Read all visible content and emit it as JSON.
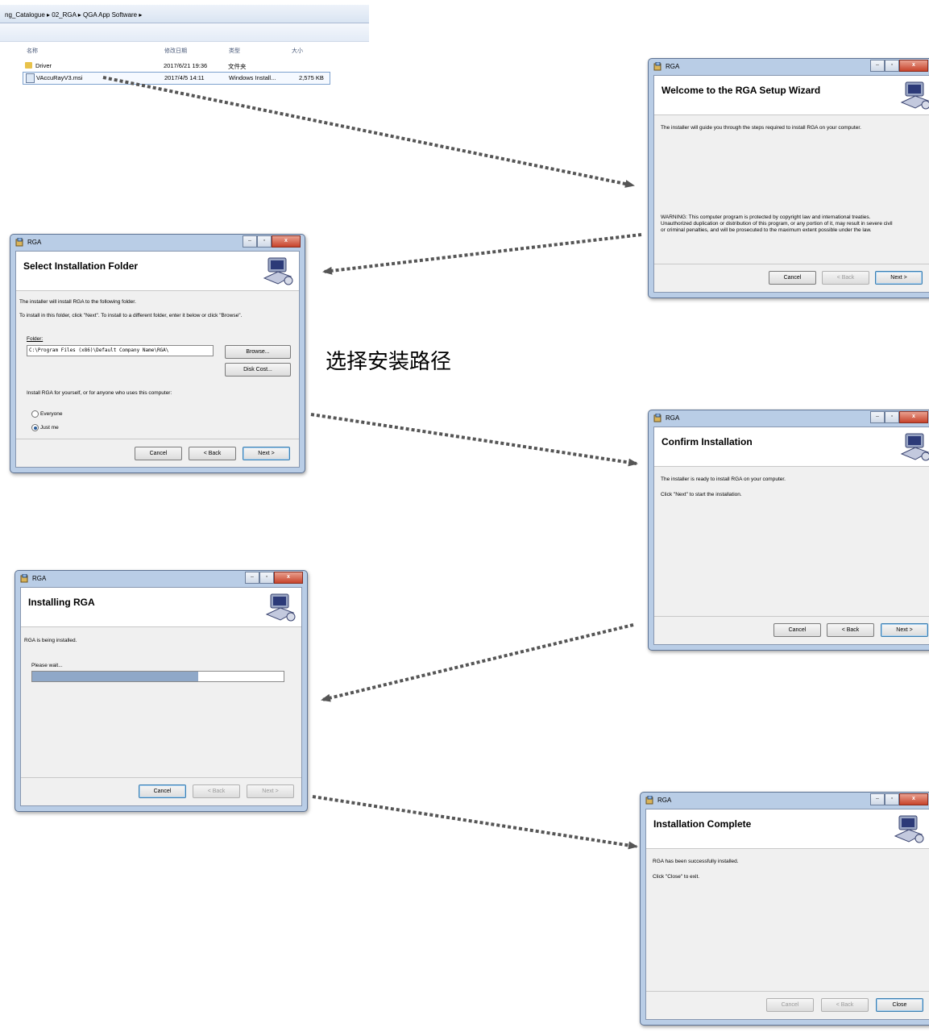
{
  "explorer": {
    "breadcrumb": "ng_Catalogue  ▸  02_RGA  ▸  QGA App Software  ▸",
    "columns": [
      "名称",
      "修改日期",
      "类型",
      "大小"
    ],
    "rows": [
      {
        "name": "Driver",
        "date": "2017/6/21 19:36",
        "type": "文件夹",
        "size": ""
      },
      {
        "name": "VAccuRayV3.msi",
        "date": "2017/4/5 14:11",
        "type": "Windows Install...",
        "size": "2,575 KB"
      }
    ]
  },
  "annotation": "选择安装路径",
  "dialogs": {
    "welcome": {
      "title": "RGA",
      "heading": "Welcome to the RGA Setup Wizard",
      "intro": "The installer will guide you through the steps required to install RGA on your computer.",
      "warning_1": "WARNING: This computer program is protected by copyright law and international treaties.",
      "warning_2": "Unauthorized duplication or distribution of this program, or any portion of it, may result in severe civil",
      "warning_3": "or criminal penalties, and will be prosecuted to the maximum extent possible under the law.",
      "cancel": "Cancel",
      "back": "< Back",
      "next": "Next >"
    },
    "folder": {
      "title": "RGA",
      "heading": "Select Installation Folder",
      "line1": "The installer will install RGA to the following folder.",
      "line2": "To install in this folder, click \"Next\". To install to a different folder, enter it below or click \"Browse\".",
      "folder_label": "Folder:",
      "folder_value": "C:\\Program Files (x86)\\Default Company Name\\RGA\\",
      "browse": "Browse...",
      "disk_cost": "Disk Cost...",
      "scope_label": "Install RGA for yourself, or for anyone who uses this computer:",
      "opt_everyone": "Everyone",
      "opt_justme": "Just me",
      "cancel": "Cancel",
      "back": "< Back",
      "next": "Next >"
    },
    "confirm": {
      "title": "RGA",
      "heading": "Confirm Installation",
      "line1": "The installer is ready to install RGA on your computer.",
      "line2": "Click \"Next\" to start the installation.",
      "cancel": "Cancel",
      "back": "< Back",
      "next": "Next >"
    },
    "installing": {
      "title": "RGA",
      "heading": "Installing RGA",
      "line1": "RGA is being installed.",
      "wait": "Please wait...",
      "progress": 0.66,
      "cancel": "Cancel",
      "back": "< Back",
      "next": "Next >"
    },
    "complete": {
      "title": "RGA",
      "heading": "Installation Complete",
      "line1": "RGA has been successfully installed.",
      "line2": "Click \"Close\" to exit.",
      "cancel": "Cancel",
      "back": "< Back",
      "close": "Close"
    }
  },
  "colors": {
    "arrow": "#555555",
    "progress_fill": "#8fa8c8",
    "title_frame": "#b9cde6"
  }
}
